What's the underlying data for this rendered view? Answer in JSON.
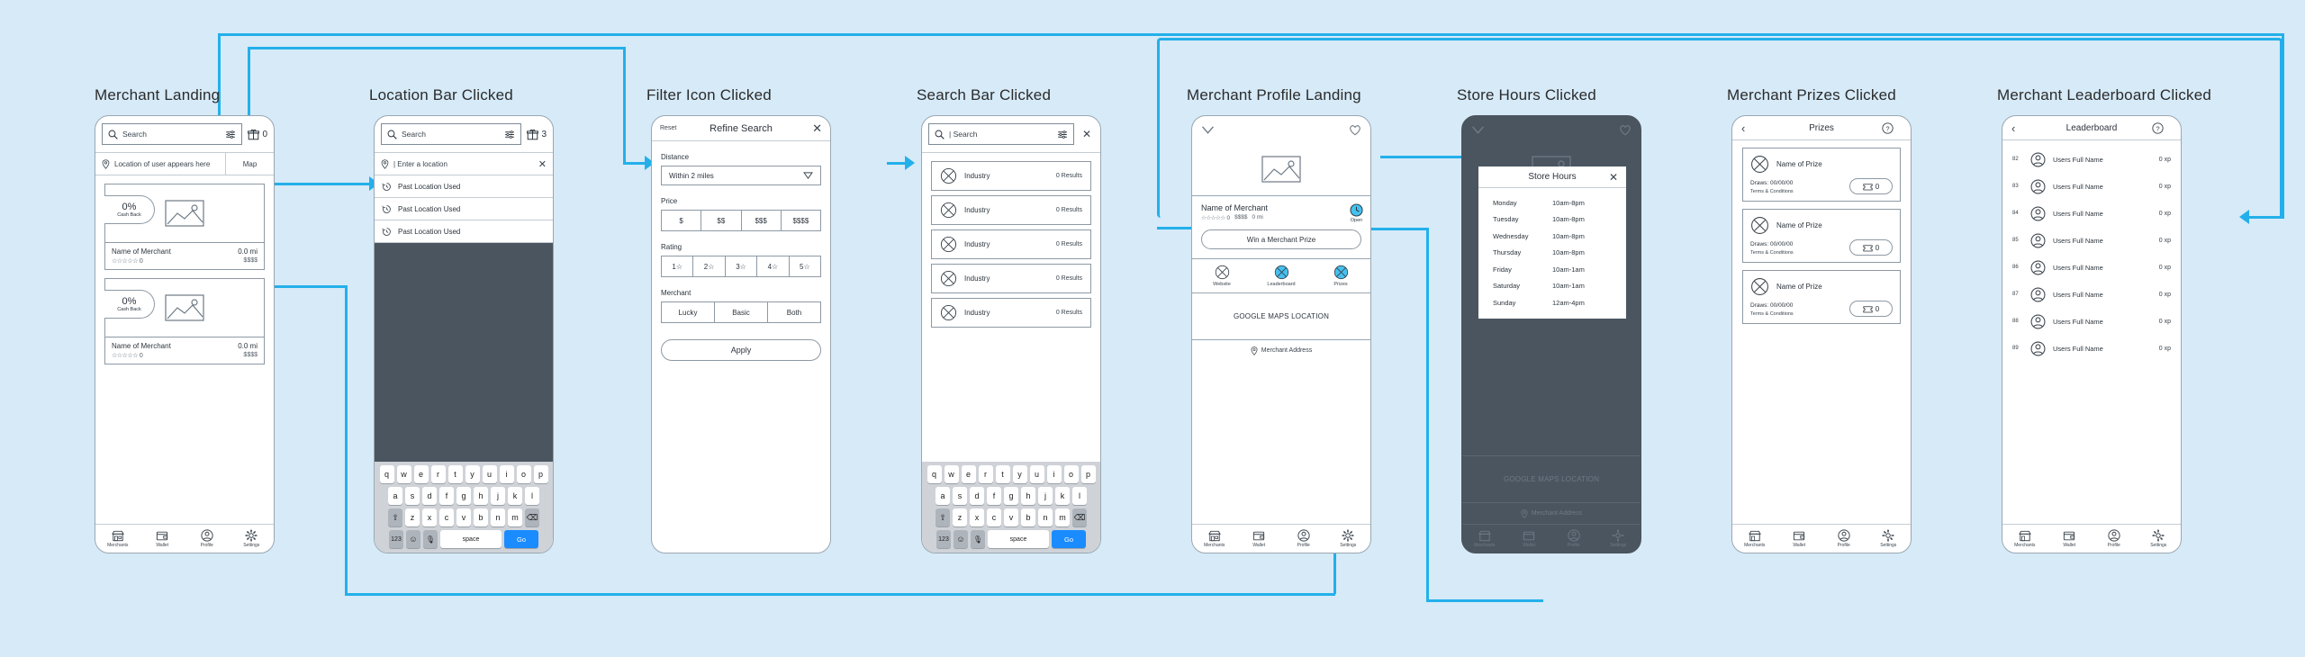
{
  "accent": "#23b0ea",
  "background": "#d6eaf8",
  "screens": [
    {
      "title": "Merchant Landing"
    },
    {
      "title": "Location Bar Clicked"
    },
    {
      "title": "Filter Icon Clicked"
    },
    {
      "title": "Search Bar Clicked"
    },
    {
      "title": "Merchant Profile Landing"
    },
    {
      "title": "Store Hours Clicked"
    },
    {
      "title": "Merchant Prizes Clicked"
    },
    {
      "title": "Merchant Leaderboard Clicked"
    }
  ],
  "tabbar": [
    {
      "label": "Merchants",
      "icon": "store-icon"
    },
    {
      "label": "Wallet",
      "icon": "wallet-icon"
    },
    {
      "label": "Profile",
      "icon": "person-icon"
    },
    {
      "label": "Settings",
      "icon": "gear-icon"
    }
  ],
  "merchant_landing": {
    "search_placeholder": "Search",
    "gift_count": "0",
    "location_text": "Location of user appears here",
    "map_label": "Map",
    "cards": [
      {
        "percent": "0%",
        "cashback": "Cash Back",
        "name": "Name of Merchant",
        "distance": "0.0 mi",
        "stars": "☆☆☆☆☆",
        "rating": "0",
        "price": "$$$$"
      },
      {
        "percent": "0%",
        "cashback": "Cash Back",
        "name": "Name of Merchant",
        "distance": "0.0 mi",
        "stars": "☆☆☆☆☆",
        "rating": "0",
        "price": "$$$$"
      }
    ]
  },
  "location_clicked": {
    "search_placeholder": "Search",
    "gift_count": "3",
    "location_input_value": "| Enter a location",
    "past_locations": [
      "Past Location Used",
      "Past Location Used",
      "Past Location Used"
    ]
  },
  "filter_clicked": {
    "reset": "Reset",
    "title": "Refine Search",
    "close": "✕",
    "distance_label": "Distance",
    "distance_value": "Within 2 miles",
    "price_label": "Price",
    "price_options": [
      "$",
      "$$",
      "$$$",
      "$$$$"
    ],
    "rating_label": "Rating",
    "rating_options": [
      "1☆",
      "2☆",
      "3☆",
      "4☆",
      "5☆"
    ],
    "merchant_label": "Merchant",
    "merchant_options": [
      "Lucky",
      "Basic",
      "Both"
    ],
    "apply": "Apply"
  },
  "search_clicked": {
    "search_value": "| Search",
    "close": "✕",
    "results": [
      {
        "name": "Industry",
        "count": "0 Results"
      },
      {
        "name": "Industry",
        "count": "0 Results"
      },
      {
        "name": "Industry",
        "count": "0 Results"
      },
      {
        "name": "Industry",
        "count": "0 Results"
      },
      {
        "name": "Industry",
        "count": "0 Results"
      }
    ]
  },
  "keyboard": {
    "row1": [
      "q",
      "w",
      "e",
      "r",
      "t",
      "y",
      "u",
      "i",
      "o",
      "p"
    ],
    "row2": [
      "a",
      "s",
      "d",
      "f",
      "g",
      "h",
      "j",
      "k",
      "l"
    ],
    "row3": [
      "z",
      "x",
      "c",
      "v",
      "b",
      "n",
      "m"
    ],
    "shift": "⇧",
    "backspace": "⌫",
    "numeric": "123",
    "emoji": "☺",
    "mic": "🎙",
    "space": "space",
    "go": "Go"
  },
  "merchant_profile": {
    "name": "Name of Merchant",
    "stars": "☆☆☆☆☆",
    "rating": "0",
    "price": "$$$$",
    "distance": "0 mi",
    "open_label": "Open",
    "win_button": "Win a Merchant Prize",
    "actions": [
      {
        "label": "Website"
      },
      {
        "label": "Leaderboard"
      },
      {
        "label": "Prizes"
      }
    ],
    "maps_placeholder": "GOOGLE MAPS LOCATION",
    "address": "Merchant Address"
  },
  "store_hours": {
    "title": "Store Hours",
    "close": "✕",
    "rows": [
      {
        "day": "Monday",
        "hours": "10am-8pm"
      },
      {
        "day": "Tuesday",
        "hours": "10am-8pm"
      },
      {
        "day": "Wednesday",
        "hours": "10am-8pm"
      },
      {
        "day": "Thursday",
        "hours": "10am-8pm"
      },
      {
        "day": "Friday",
        "hours": "10am-1am"
      },
      {
        "day": "Saturday",
        "hours": "10am-1am"
      },
      {
        "day": "Sunday",
        "hours": "12am-4pm"
      }
    ]
  },
  "prizes": {
    "title": "Prizes",
    "back": "‹",
    "help": "?",
    "cards": [
      {
        "name": "Name of Prize",
        "draws": "Draws:  00/00/00",
        "terms": "Terms & Conditions",
        "tickets": "0"
      },
      {
        "name": "Name of Prize",
        "draws": "Draws:  00/00/00",
        "terms": "Terms & Conditions",
        "tickets": "0"
      },
      {
        "name": "Name of Prize",
        "draws": "Draws:  00/00/00",
        "terms": "Terms & Conditions",
        "tickets": "0"
      }
    ]
  },
  "leaderboard": {
    "title": "Leaderboard",
    "back": "‹",
    "help": "?",
    "rows": [
      {
        "rank": "82",
        "name": "Users Full Name",
        "xp": "0 xp"
      },
      {
        "rank": "83",
        "name": "Users Full Name",
        "xp": "0 xp"
      },
      {
        "rank": "84",
        "name": "Users Full Name",
        "xp": "0 xp"
      },
      {
        "rank": "85",
        "name": "Users Full Name",
        "xp": "0 xp"
      },
      {
        "rank": "86",
        "name": "Users Full Name",
        "xp": "0 xp"
      },
      {
        "rank": "87",
        "name": "Users Full Name",
        "xp": "0 xp"
      },
      {
        "rank": "88",
        "name": "Users Full Name",
        "xp": "0 xp"
      },
      {
        "rank": "89",
        "name": "Users Full Name",
        "xp": "0 xp"
      }
    ]
  }
}
